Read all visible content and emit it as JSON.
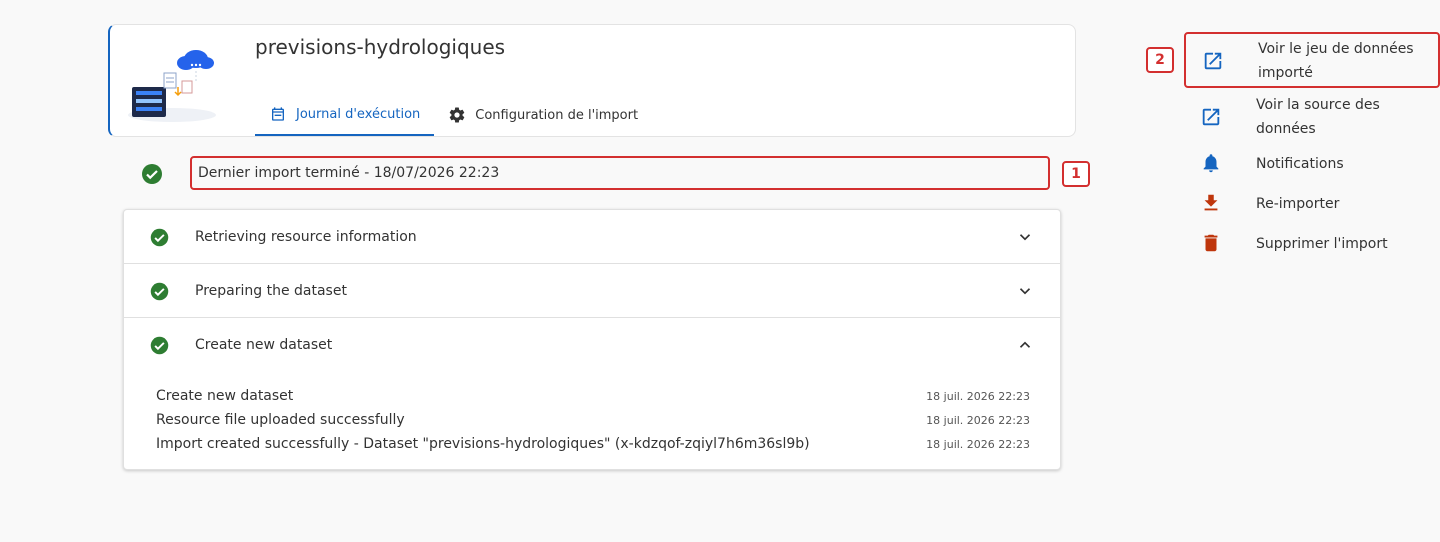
{
  "header": {
    "title": "previsions-hydrologiques",
    "tabs": [
      {
        "label": "Journal d'exécution",
        "icon": "calendar-icon",
        "active": true
      },
      {
        "label": "Configuration de l'import",
        "icon": "gear-icon",
        "active": false
      }
    ]
  },
  "status": {
    "text": "Dernier import terminé - 18/07/2026 22:23",
    "icon": "check-circle-icon",
    "color": "#2e7d32"
  },
  "markers": [
    "1",
    "2"
  ],
  "steps": [
    {
      "label": "Retrieving resource information",
      "expanded": false
    },
    {
      "label": "Preparing the dataset",
      "expanded": false
    },
    {
      "label": "Create new dataset",
      "expanded": true
    }
  ],
  "logs": [
    {
      "message": "Create new dataset",
      "time": "18 juil. 2026 22:23"
    },
    {
      "message": "Resource file uploaded successfully",
      "time": "18 juil. 2026 22:23"
    },
    {
      "message": "Import created successfully - Dataset \"previsions-hydrologiques\" (x-kdzqof-zqiyl7h6m36sl9b)",
      "time": "18 juil. 2026 22:23"
    }
  ],
  "actions": [
    {
      "line1": "Voir le jeu de données",
      "line2": "importé",
      "icon": "open-in-new-icon",
      "color": "#1565c0"
    },
    {
      "line1": "Voir la source des",
      "line2": "données",
      "icon": "open-in-new-icon",
      "color": "#1565c0"
    },
    {
      "line1": "Notifications",
      "icon": "bell-icon",
      "color": "#1565c0"
    },
    {
      "line1": "Re-importer",
      "icon": "download-icon",
      "color": "#bf360c"
    },
    {
      "line1": "Supprimer l'import",
      "icon": "trash-icon",
      "color": "#bf360c"
    }
  ],
  "colors": {
    "accent": "#1565c0",
    "success": "#2e7d32",
    "danger": "#bf360c",
    "highlight": "#d32f2f"
  }
}
